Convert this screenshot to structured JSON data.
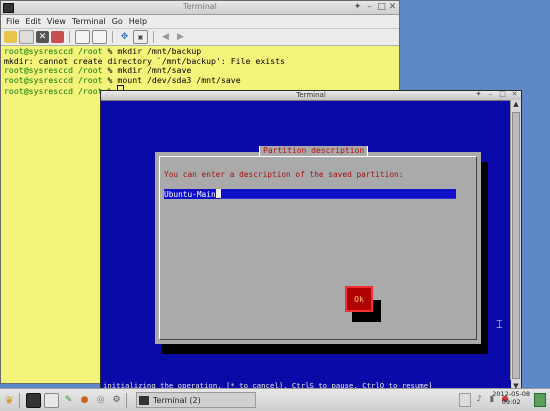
{
  "back_terminal": {
    "title": "Terminal",
    "menu": [
      "File",
      "Edit",
      "View",
      "Terminal",
      "Go",
      "Help"
    ],
    "lines": [
      {
        "prompt": "root@sysresccd",
        "path": "/root",
        "cmd": "% mkdir /mnt/backup"
      },
      {
        "text": "mkdir: cannot create directory `/mnt/backup': File exists"
      },
      {
        "prompt": "root@sysresccd",
        "path": "/root",
        "cmd": "% mkdir /mnt/save"
      },
      {
        "prompt": "root@sysresccd",
        "path": "/root",
        "cmd": "% mount /dev/sda3 /mnt/save"
      },
      {
        "prompt": "root@sysresccd",
        "path": "/root",
        "cmd": "% "
      }
    ]
  },
  "front_terminal": {
    "title": "Terminal",
    "dialog": {
      "title": "Partition description",
      "prompt": "You can enter a description of the saved partition:",
      "input_value": "Ubuntu-Main",
      "ok_label": "Ok"
    },
    "status_line": "initializing the operation. [* to cancel], CtrlS to pause, CtrlQ to resume]"
  },
  "taskbar": {
    "task_label": "Terminal (2)",
    "clock_date": "2012-05-08",
    "clock_time": "09:02"
  },
  "colors": {
    "back_bg": "#f4f47a",
    "front_bg": "#0a0aa8",
    "dialog_bg": "#aaaaaa",
    "ok_button": "#b00000",
    "desktop": "#5f88c8"
  }
}
